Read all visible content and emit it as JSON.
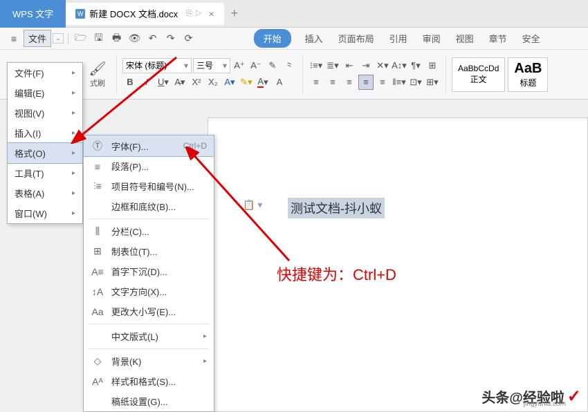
{
  "titlebar": {
    "app_name": "WPS 文字",
    "doc_icon": "W",
    "doc_name": "新建 DOCX 文档.docx",
    "tab_status": "⎘  ▷",
    "new_tab": "+"
  },
  "toolbar": {
    "menu_label": "文件",
    "ribbon_tabs": [
      "开始",
      "插入",
      "页面布局",
      "引用",
      "审阅",
      "视图",
      "章节",
      "安全"
    ]
  },
  "ribbon": {
    "format_painter": "式刷",
    "font_name": "宋体 (标题)",
    "font_size": "三号",
    "style1_preview": "AaBbCcDd",
    "style1_label": "正文",
    "style2_preview": "AaB",
    "style2_label": "标题"
  },
  "menu1": {
    "items": [
      {
        "label": "文件(F)"
      },
      {
        "label": "编辑(E)"
      },
      {
        "label": "视图(V)"
      },
      {
        "label": "插入(I)"
      },
      {
        "label": "格式(O)"
      },
      {
        "label": "工具(T)"
      },
      {
        "label": "表格(A)"
      },
      {
        "label": "窗口(W)"
      }
    ]
  },
  "menu2": {
    "items": [
      {
        "icon": "Ⓣ",
        "label": "字体(F)...",
        "shortcut": "Ctrl+D"
      },
      {
        "icon": "≡",
        "label": "段落(P)..."
      },
      {
        "icon": "⫶≡",
        "label": "项目符号和编号(N)..."
      },
      {
        "icon": "",
        "label": "边框和底纹(B)..."
      },
      {
        "sep": true
      },
      {
        "icon": "⫼",
        "label": "分栏(C)..."
      },
      {
        "icon": "⊞",
        "label": "制表位(T)..."
      },
      {
        "icon": "A≡",
        "label": "首字下沉(D)..."
      },
      {
        "icon": "↕A",
        "label": "文字方向(X)..."
      },
      {
        "icon": "Aa",
        "label": "更改大小写(E)..."
      },
      {
        "sep": true
      },
      {
        "icon": "",
        "label": "中文版式(L)",
        "arrow": true
      },
      {
        "sep": true
      },
      {
        "icon": "◇",
        "label": "背景(K)",
        "arrow": true
      },
      {
        "icon": "Aᴬ",
        "label": "样式和格式(S)..."
      },
      {
        "icon": "",
        "label": "稿纸设置(G)..."
      }
    ]
  },
  "document": {
    "selected_text": "测试文档-抖小蚁",
    "paste_hint": "📋 ▾"
  },
  "annotation": "快捷键为：Ctrl+D",
  "watermark": {
    "text": "头条@经验啦",
    "sub": "jingyanla.com",
    "check": "✓"
  }
}
